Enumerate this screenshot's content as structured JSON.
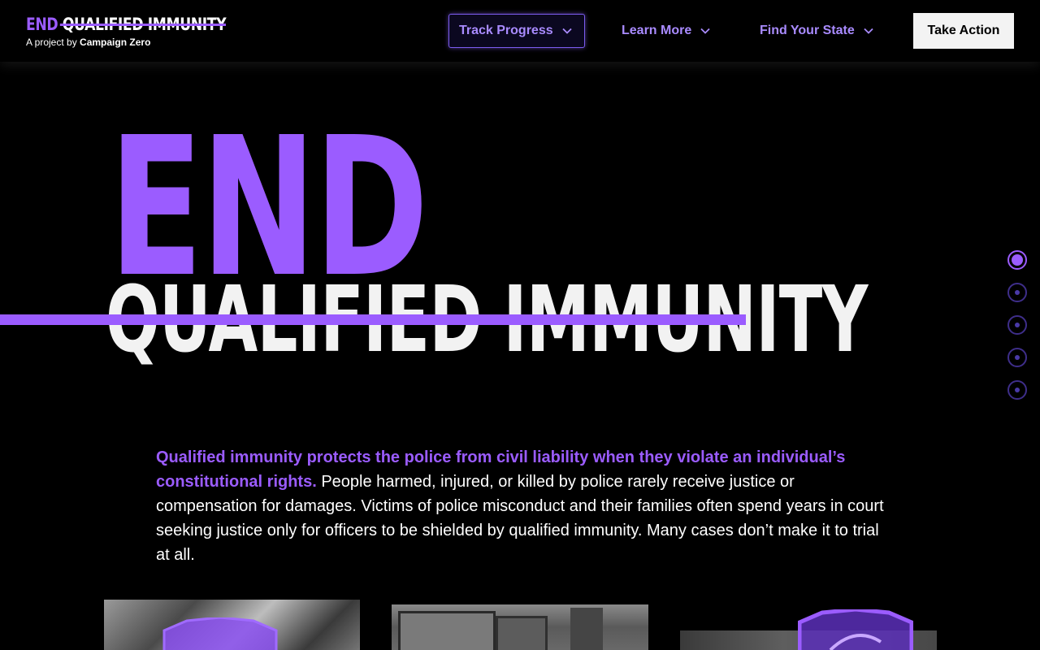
{
  "header": {
    "logo": {
      "end": "END",
      "qualified_immunity": "QUALIFIED IMMUNITY",
      "subtitle_prefix": "A project by",
      "subtitle_org": "Campaign Zero"
    },
    "nav": [
      {
        "label": "Track Progress",
        "icon": "chevron-down-icon",
        "active": true
      },
      {
        "label": "Learn More",
        "icon": "chevron-down-icon",
        "active": false
      },
      {
        "label": "Find Your State",
        "icon": "chevron-down-icon",
        "active": false
      }
    ],
    "cta_label": "Take Action"
  },
  "hero": {
    "end": "END",
    "qualified_immunity": "QUALIFIED IMMUNITY"
  },
  "section_nav": {
    "count": 5,
    "active_index": 0
  },
  "intro": {
    "highlight": "Qualified immunity protects the police from civil liability when they violate an individual’s constitutional rights.",
    "body": " People harmed, injured, or killed by police rarely receive justice or compensation for damages. Victims of police misconduct and their families often spend years in court seeking justice only for officers to be shielded by qualified immunity. Many cases don’t make it to trial at all."
  },
  "colors": {
    "accent": "#9b5cff",
    "nav_text": "#a98bff",
    "background": "#000000",
    "text": "#ffffff",
    "cta_background": "#f3f3f3"
  }
}
